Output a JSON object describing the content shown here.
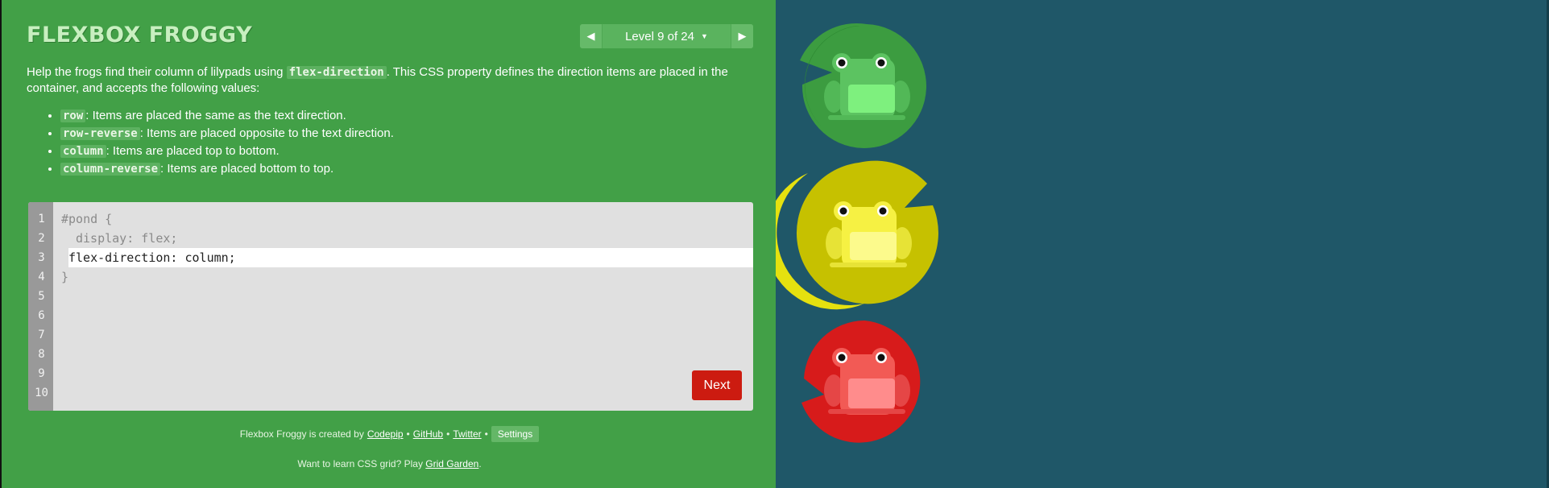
{
  "app": {
    "title": "FLEXBOX FROGGY"
  },
  "level_nav": {
    "prev_icon": "triangle-left",
    "label": "Level 9 of 24",
    "next_icon": "triangle-right"
  },
  "instructions": {
    "intro_before": "Help the frogs find their column of lilypads using ",
    "intro_code": "flex-direction",
    "intro_after": ". This CSS property defines the direction items are placed in the container, and accepts the following values:",
    "values": [
      {
        "code": "row",
        "text": ": Items are placed the same as the text direction."
      },
      {
        "code": "row-reverse",
        "text": ": Items are placed opposite to the text direction."
      },
      {
        "code": "column",
        "text": ": Items are placed top to bottom."
      },
      {
        "code": "column-reverse",
        "text": ": Items are placed bottom to top."
      }
    ]
  },
  "editor": {
    "line_numbers": [
      "1",
      "2",
      "3",
      "4",
      "5",
      "6",
      "7",
      "8",
      "9",
      "10"
    ],
    "line1": "#pond {",
    "line2": "display: flex;",
    "input_value": "flex-direction: column;",
    "line4": "}",
    "next_label": "Next"
  },
  "footer": {
    "credits_prefix": "Flexbox Froggy is created by",
    "codepip": "Codepip",
    "sep": "•",
    "github": "GitHub",
    "twitter": "Twitter",
    "settings": "Settings",
    "grid_prefix": "Want to learn CSS grid? Play",
    "grid_link": "Grid Garden",
    "grid_suffix": "."
  },
  "colors": {
    "sidebar_bg": "#42a047",
    "pond_bg": "#1f5768",
    "green_frog": "#59c35e",
    "yellow_frog": "#f9f345",
    "red_frog": "#f2504a",
    "next_button": "#cc1b10"
  },
  "frogs": [
    {
      "color": "green"
    },
    {
      "color": "yellow"
    },
    {
      "color": "red"
    }
  ]
}
